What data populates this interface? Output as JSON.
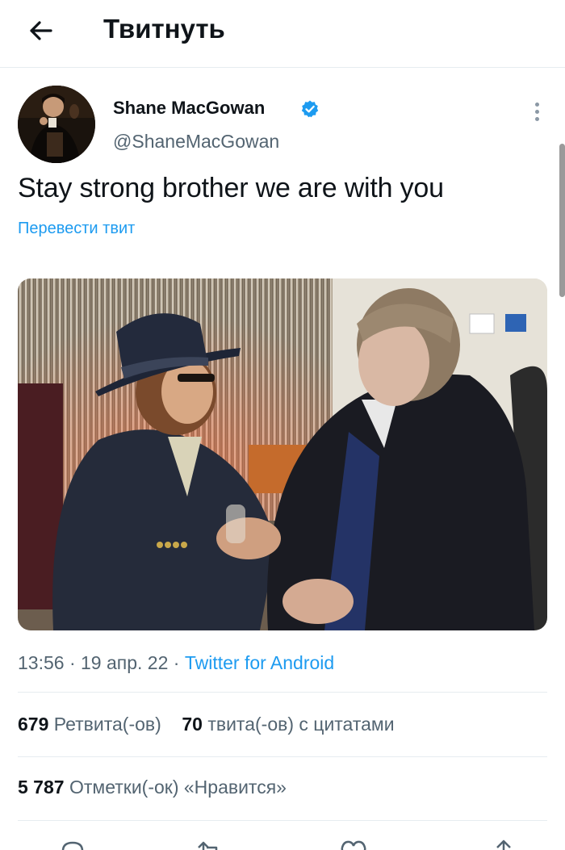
{
  "header": {
    "title": "Твитнуть",
    "back_icon": "arrow-left-icon"
  },
  "author": {
    "name": "Shane MacGowan",
    "handle": "@ShaneMacGowan",
    "verified": true,
    "verified_color": "#1d9bf0"
  },
  "tweet": {
    "text": "Stay strong brother we are with you",
    "translate_label": "Перевести твит"
  },
  "meta": {
    "time": "13:56",
    "separator": "·",
    "date": "19 апр. 22",
    "source": "Twitter for Android"
  },
  "stats": {
    "retweets_count": "679",
    "retweets_label": "Ретвита(-ов)",
    "quotes_count": "70",
    "quotes_label": "твита(-ов) с цитатами",
    "likes_count": "5 787",
    "likes_label": "Отметки(-ок) «Нравится»"
  },
  "actions": [
    "reply-icon",
    "retweet-icon",
    "like-icon",
    "share-icon"
  ],
  "colors": {
    "accent": "#1d9bf0",
    "muted": "#536471",
    "text": "#0f1419",
    "divider": "#e6ecf0"
  }
}
